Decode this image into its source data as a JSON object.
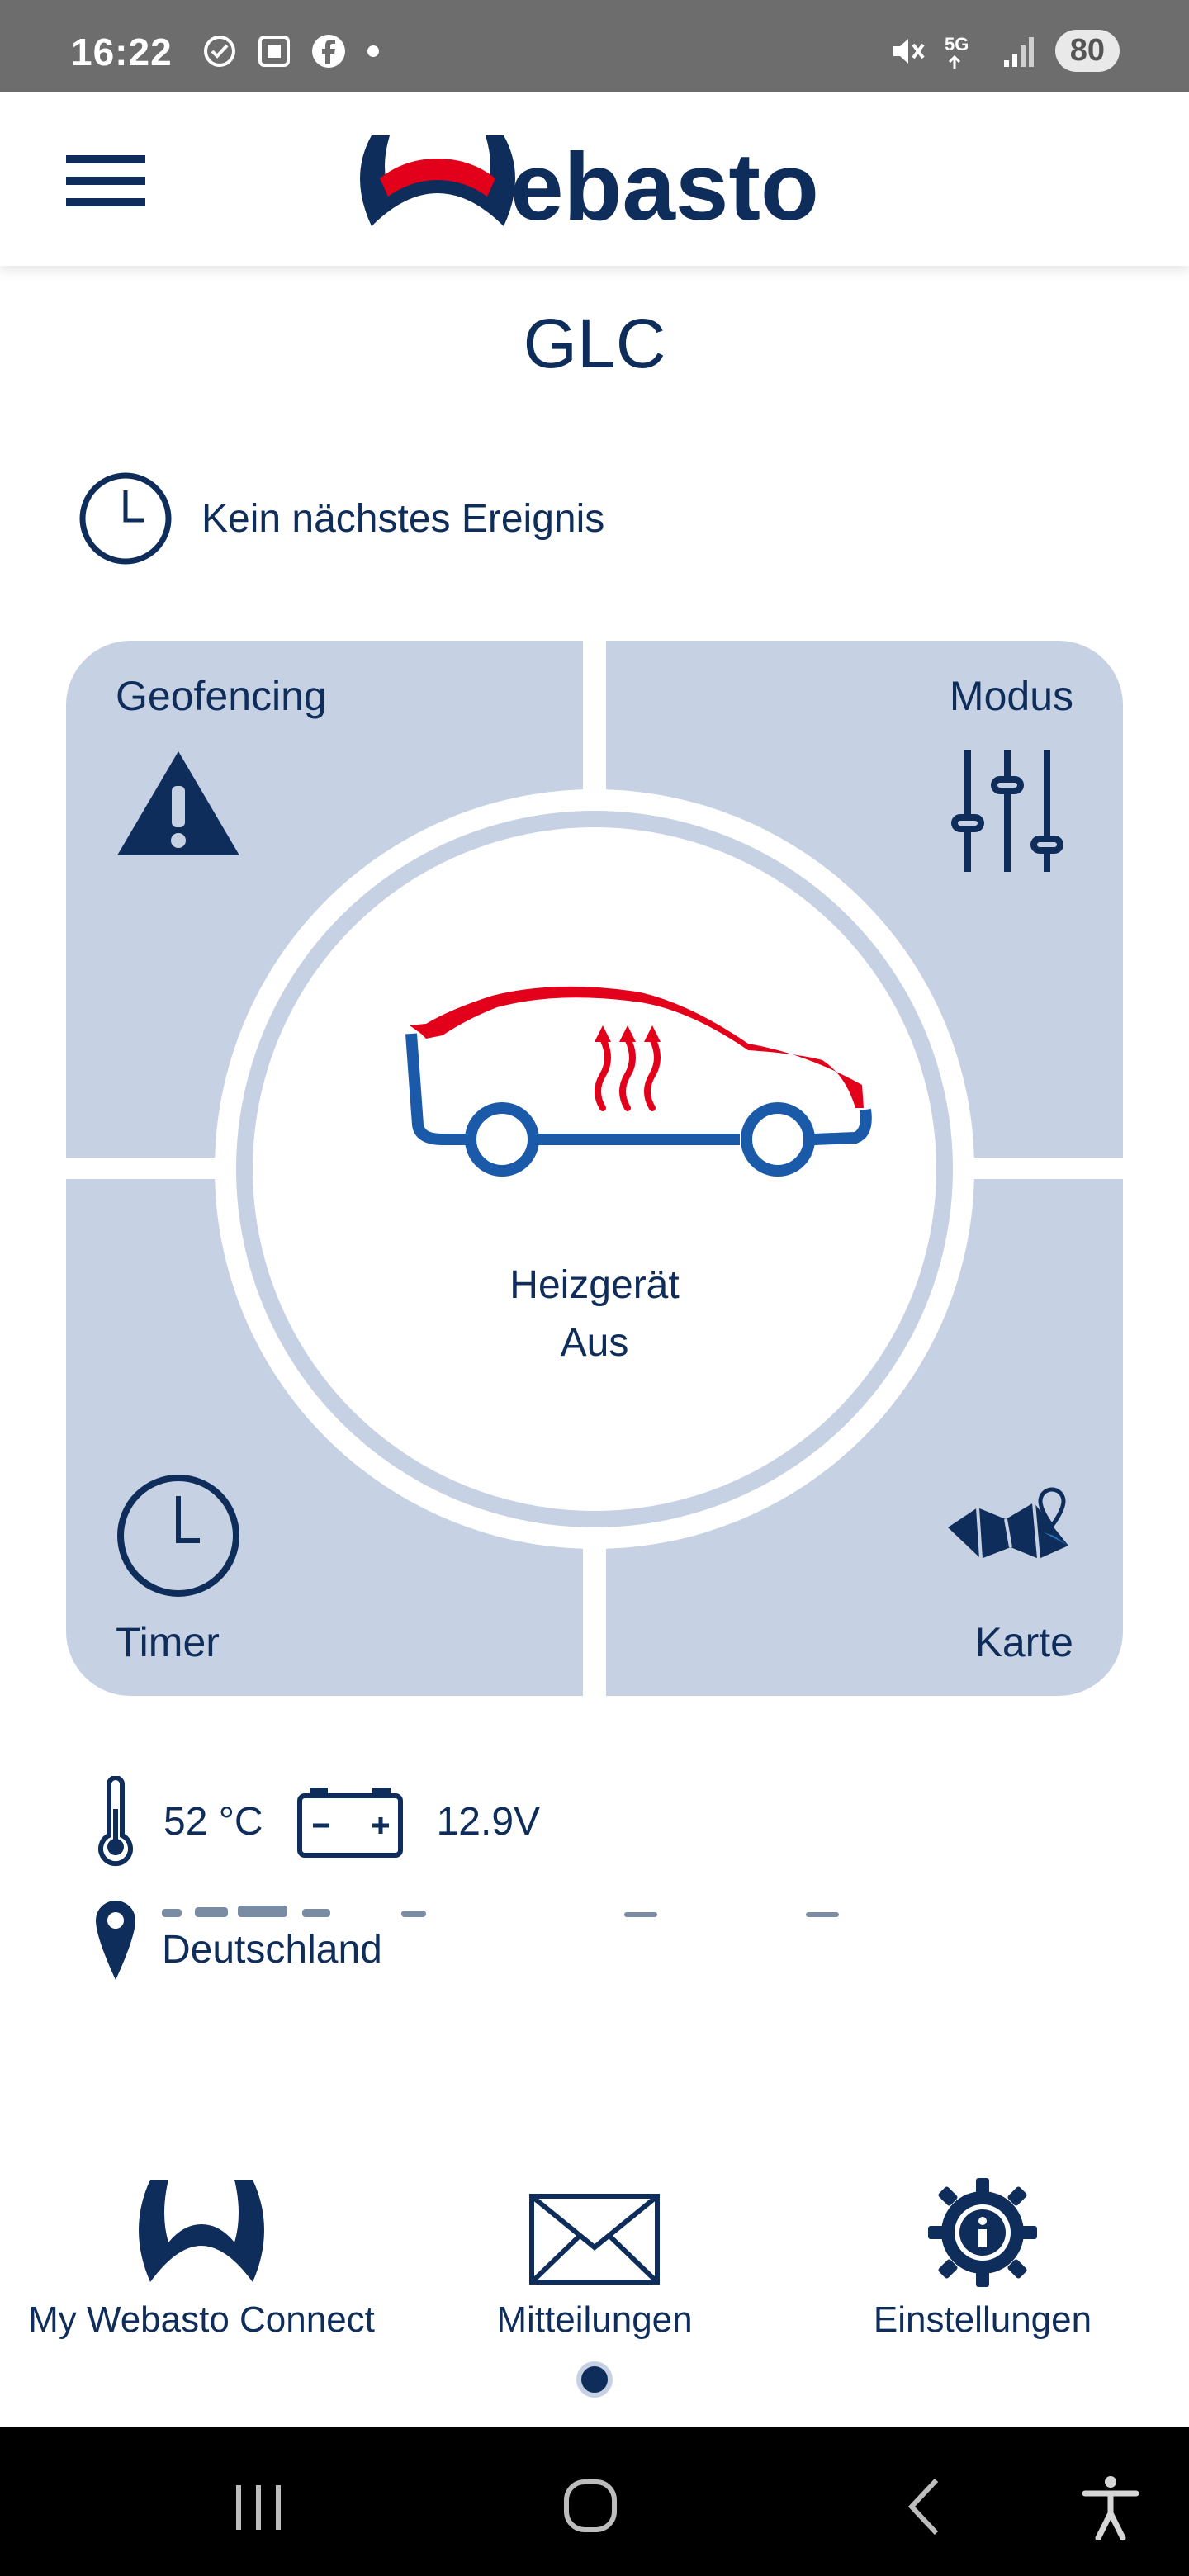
{
  "status_bar": {
    "time": "16:22",
    "network": "5G",
    "battery": "80"
  },
  "header": {
    "brand": "Webasto",
    "brand_letters": "ebasto"
  },
  "vehicle": {
    "name": "GLC"
  },
  "next_event": {
    "text": "Kein nächstes Ereignis"
  },
  "tiles": {
    "geofencing": "Geofencing",
    "mode": "Modus",
    "timer": "Timer",
    "map": "Karte"
  },
  "heater": {
    "label": "Heizgerät",
    "state": "Aus"
  },
  "vehicle_info": {
    "temperature": "52 °C",
    "voltage": "12.9V",
    "location_country": "Deutschland"
  },
  "bottom_nav": {
    "items": [
      {
        "label": "My Webasto Connect"
      },
      {
        "label": "Mitteilungen"
      },
      {
        "label": "Einstellungen"
      }
    ]
  },
  "colors": {
    "brand_blue": "#0f2d5a",
    "brand_red": "#e2001a",
    "tile_bg": "#c6d1e3",
    "car_blue": "#1a5aa8"
  }
}
